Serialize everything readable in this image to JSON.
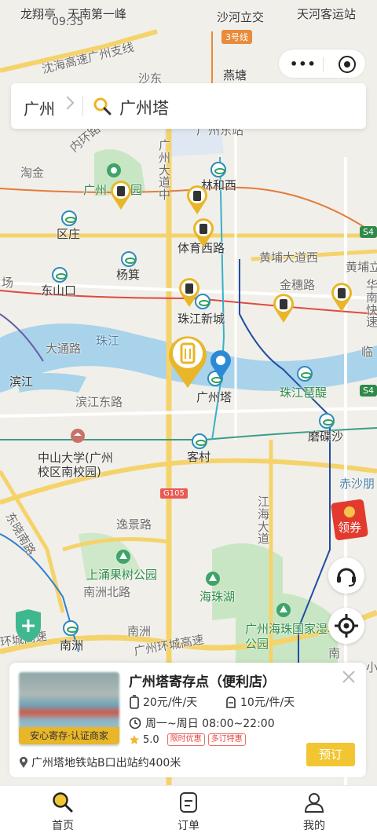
{
  "status_bar": {
    "time": "09:35"
  },
  "map": {
    "labels": {
      "longxiangting": "龙翔亭",
      "tiannan": "天南第一峰",
      "shahe": "沙河立交",
      "tianhe_station": "天河客运站",
      "yantang": "燕塘",
      "shenhai": "沈海高速广州支线",
      "shadong": "沙东",
      "neihuan": "内环路",
      "guangzhou_dongzhan": "广州东站",
      "taojin": "淘金",
      "guangzhou_park": "广州",
      "park_suffix": "园",
      "linhexi": "林和西",
      "guangzhou_dadao": "广州大道中",
      "quzhuang": "区庄",
      "tiyuxilu": "体育西路",
      "huangpu_dadaoxi": "黄埔大道西",
      "huangpu_short": "黄埔立",
      "dongshankou": "东山口",
      "yangji": "杨箕",
      "jinsuilu": "金穗路",
      "chang": "场",
      "zhujiang_xincheng": "珠江新城",
      "zhujiang": "珠江",
      "datonglu": "大通路",
      "binjiang": "滨江",
      "guangzhouta": "广州塔",
      "zhujiang_pixing": "珠江琶醍",
      "binjiang_donglu": "滨江东路",
      "mobisha": "磨碟沙",
      "zhongshan_univ": "中山大学(广州校区南校园)",
      "kecun": "客村",
      "chishagang": "赤沙朋",
      "dongxiaonanlu": "东晓南路",
      "yijingjie": "逸景路",
      "jianghaidadao": "江海大道",
      "shangyong_park": "上涌果树公园",
      "nanzhoubeilu": "南洲北路",
      "haizhuhu": "海珠湖",
      "nanzhou_area": "南洲",
      "huanchenggaosu": "广州环城高速",
      "haizhu_wetland": "广州海珠国家湿地公园",
      "nanzhou": "南洲",
      "huancheng_left": "环城高速",
      "hua_right": "华南快速",
      "lin_right": "临",
      "xiao_right": "小",
      "nan_right": "南"
    },
    "badges": {
      "metro3": "3号线",
      "s4": "S4",
      "s4b": "S4",
      "g105": "G105"
    }
  },
  "top_capsule": {
    "more": "•••"
  },
  "search": {
    "city": "广州",
    "keyword": "广州塔"
  },
  "hongbao": {
    "label": "领券"
  },
  "store_card": {
    "name": "广州塔寄存点（便利店）",
    "thumb_tag": "安心寄存·认证商家",
    "price_luggage": "20元/件/天",
    "price_bag": "10元/件/天",
    "hours": "周一~周日 08:00~22:00",
    "rating": "5.0",
    "tag1": "限时优惠",
    "tag2": "多订特惠",
    "address": "广州塔地铁站B口出站约400米",
    "book_label": "预订"
  },
  "tabs": [
    {
      "label": "首页",
      "active": true
    },
    {
      "label": "订单",
      "active": false
    },
    {
      "label": "我的",
      "active": false
    }
  ],
  "colors": {
    "accent": "#f2c533",
    "pin": "#e8b628",
    "river": "#a9d3ea",
    "green": "#c9e6c4"
  }
}
